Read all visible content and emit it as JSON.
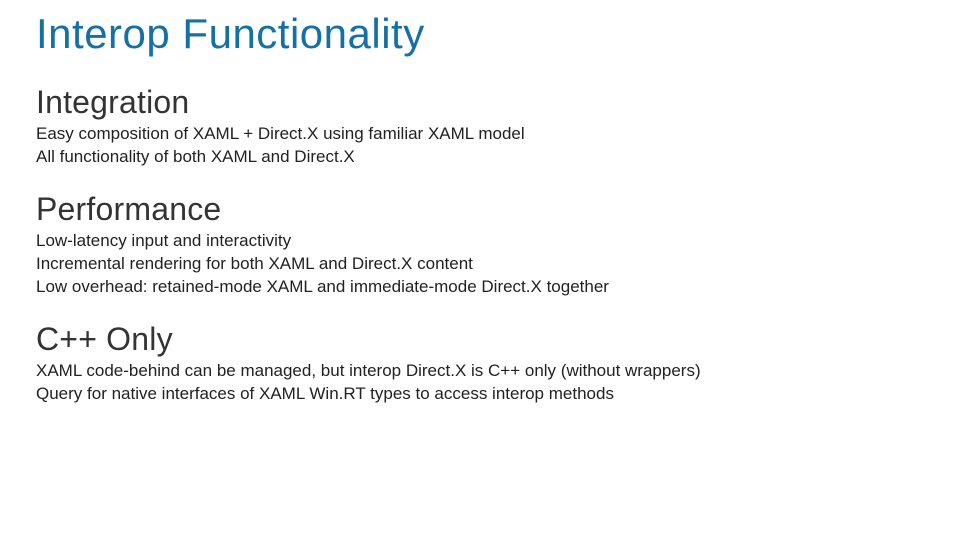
{
  "title": "Interop Functionality",
  "sections": [
    {
      "heading": "Integration",
      "lines": [
        "Easy composition of XAML + Direct.X using familiar XAML model",
        "All functionality of both XAML and Direct.X"
      ]
    },
    {
      "heading": "Performance",
      "lines": [
        "Low-latency input and interactivity",
        "Incremental rendering for both XAML and Direct.X content",
        "Low overhead: retained-mode XAML and immediate-mode Direct.X together"
      ]
    },
    {
      "heading": "C++ Only",
      "lines": [
        "XAML code-behind can be managed, but interop Direct.X is C++ only (without wrappers)",
        "Query for native interfaces of XAML Win.RT types to access interop methods"
      ]
    }
  ]
}
